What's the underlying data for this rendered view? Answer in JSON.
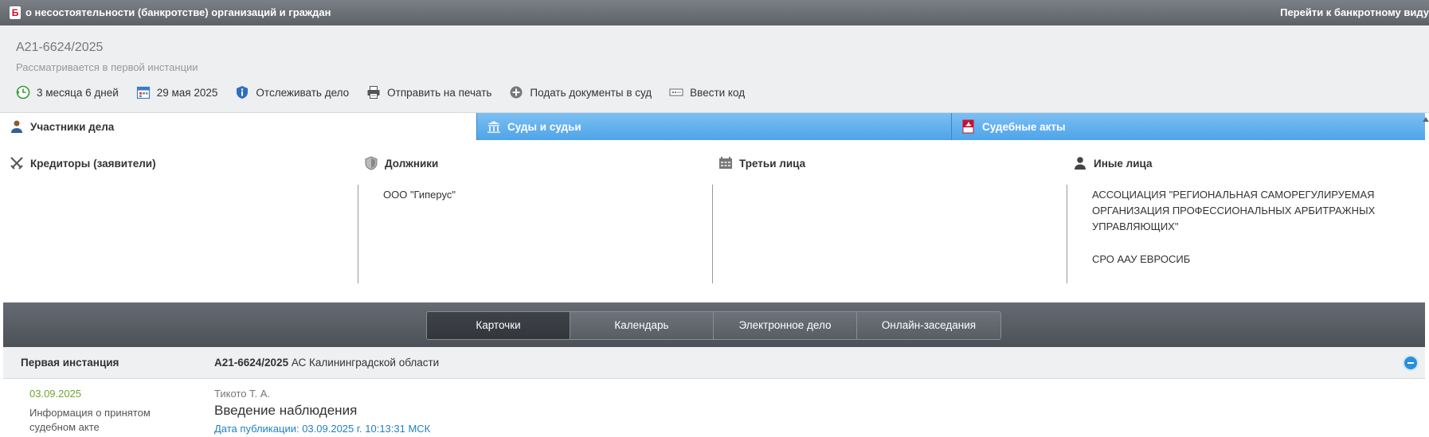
{
  "topbar": {
    "logo_letter": "Б",
    "title": "о несостоятельности (банкротстве) организаций и граждан",
    "goto_link": "Перейти к банкротному виду"
  },
  "case": {
    "number": "А21-6624/2025",
    "status": "Рассматривается в первой инстанции"
  },
  "actions": [
    {
      "icon": "clock-icon",
      "label": "3 месяца 6 дней"
    },
    {
      "icon": "calendar-icon",
      "label": "29 мая 2025"
    },
    {
      "icon": "shield-info-icon",
      "label": "Отслеживать дело"
    },
    {
      "icon": "printer-icon",
      "label": "Отправить на печать"
    },
    {
      "icon": "plus-circle-icon",
      "label": "Подать документы в суд"
    },
    {
      "icon": "code-icon",
      "label": "Ввести код"
    }
  ],
  "tabs": [
    {
      "icon": "person-icon",
      "label": "Участники дела"
    },
    {
      "icon": "courthouse-icon",
      "label": "Суды и судьи"
    },
    {
      "icon": "pdf-icon",
      "label": "Судебные акты"
    }
  ],
  "parties": {
    "creditors": {
      "title": "Кредиторы (заявители)",
      "items": []
    },
    "debtors": {
      "title": "Должники",
      "items": [
        "ООО \"Гиперус\""
      ]
    },
    "third": {
      "title": "Третьи лица",
      "items": []
    },
    "other": {
      "title": "Иные лица",
      "items": [
        "АССОЦИАЦИЯ \"РЕГИОНАЛЬНАЯ САМОРЕГУЛИРУЕМАЯ ОРГАНИЗАЦИЯ ПРОФЕССИОНАЛЬНЫХ АРБИТРАЖНЫХ УПРАВЛЯЮЩИХ\"",
        "СРО ААУ ЕВРОСИБ"
      ]
    }
  },
  "nav": {
    "buttons": [
      "Карточки",
      "Календарь",
      "Электронное дело",
      "Онлайн-заседания"
    ],
    "active": "Карточки"
  },
  "instance": {
    "label": "Первая инстанция",
    "case_number": "А21-6624/2025",
    "court": "АС Калининградской области"
  },
  "document": {
    "date": "03.09.2025",
    "kind": "Информация о принятом судебном акте",
    "judge": "Тикото Т. А.",
    "title": "Введение наблюдения",
    "published": "Дата публикации: 03.09.2025 г. 10:13:31 МСК"
  },
  "colors": {
    "tab_blue": "#4fa4e8",
    "date_green": "#6aa82e",
    "link_blue": "#1f7fc6",
    "logo_red": "#c8102e"
  }
}
